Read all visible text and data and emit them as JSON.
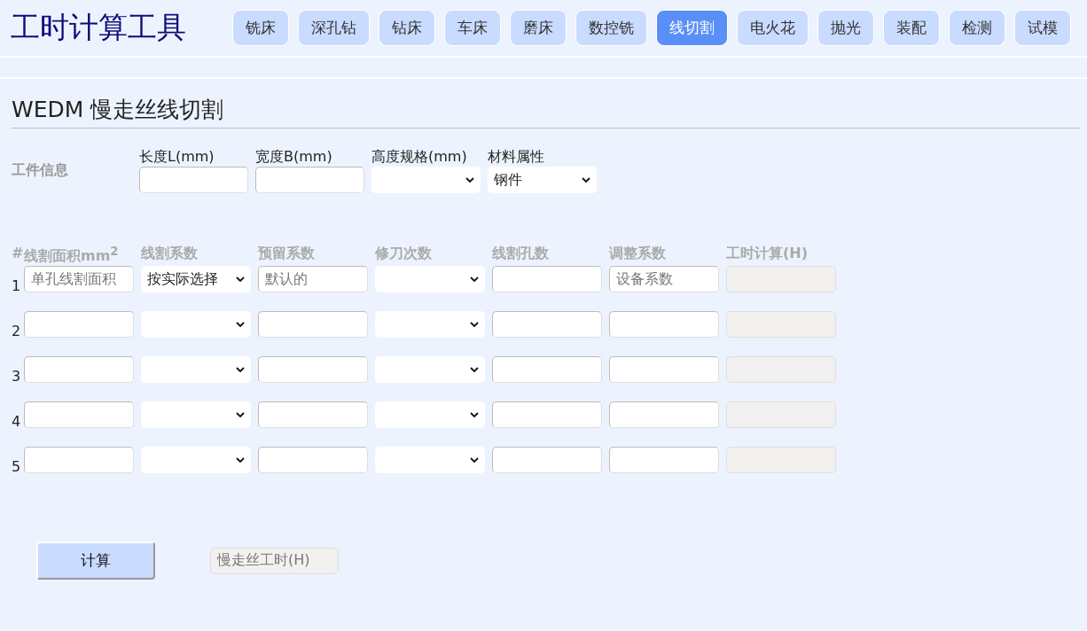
{
  "app_title": "工时计算工具",
  "tabs": [
    {
      "label": "铣床",
      "selected": false
    },
    {
      "label": "深孔钻",
      "selected": false
    },
    {
      "label": "钻床",
      "selected": false
    },
    {
      "label": "车床",
      "selected": false
    },
    {
      "label": "磨床",
      "selected": false
    },
    {
      "label": "数控铣",
      "selected": false
    },
    {
      "label": "线切割",
      "selected": true
    },
    {
      "label": "电火花",
      "selected": false
    },
    {
      "label": "抛光",
      "selected": false
    },
    {
      "label": "装配",
      "selected": false
    },
    {
      "label": "检测",
      "selected": false
    },
    {
      "label": "试模",
      "selected": false
    }
  ],
  "section_title": "WEDM 慢走丝线切割",
  "workpiece": {
    "label": "工件信息",
    "fields": [
      {
        "kind": "input",
        "label": "长度L(mm)"
      },
      {
        "kind": "input",
        "label": "宽度B(mm)"
      },
      {
        "kind": "select",
        "label": "高度规格(mm)"
      },
      {
        "kind": "select",
        "label": "材料属性",
        "value": "钢件"
      }
    ]
  },
  "table": {
    "index_header": "#",
    "columns": [
      "线割面积mm$^{2}$",
      "线割系数",
      "预留系数",
      "修刀次数",
      "线割孔数",
      "调整系数",
      "工时计算(H)"
    ],
    "rows": [
      {
        "number": "1",
        "cells": [
          {
            "kind": "input",
            "placeholder": "单孔线割面积"
          },
          {
            "kind": "select",
            "value": "按实际选择"
          },
          {
            "kind": "input",
            "placeholder": "默认的"
          },
          {
            "kind": "select"
          },
          {
            "kind": "input"
          },
          {
            "kind": "input",
            "placeholder": "设备系数"
          },
          {
            "kind": "output"
          }
        ]
      },
      {
        "number": "2",
        "cells": [
          {
            "kind": "input"
          },
          {
            "kind": "select"
          },
          {
            "kind": "input"
          },
          {
            "kind": "select"
          },
          {
            "kind": "input"
          },
          {
            "kind": "input"
          },
          {
            "kind": "output"
          }
        ]
      },
      {
        "number": "3",
        "cells": [
          {
            "kind": "input"
          },
          {
            "kind": "select"
          },
          {
            "kind": "input"
          },
          {
            "kind": "select"
          },
          {
            "kind": "input"
          },
          {
            "kind": "input"
          },
          {
            "kind": "output"
          }
        ]
      },
      {
        "number": "4",
        "cells": [
          {
            "kind": "input"
          },
          {
            "kind": "select"
          },
          {
            "kind": "input"
          },
          {
            "kind": "select"
          },
          {
            "kind": "input"
          },
          {
            "kind": "input"
          },
          {
            "kind": "output"
          }
        ]
      },
      {
        "number": "5",
        "cells": [
          {
            "kind": "input"
          },
          {
            "kind": "select"
          },
          {
            "kind": "input"
          },
          {
            "kind": "select"
          },
          {
            "kind": "input"
          },
          {
            "kind": "input"
          },
          {
            "kind": "output"
          }
        ]
      }
    ]
  },
  "calculate_button": "计算",
  "result": {
    "placeholder": "慢走丝工时(H)"
  }
}
